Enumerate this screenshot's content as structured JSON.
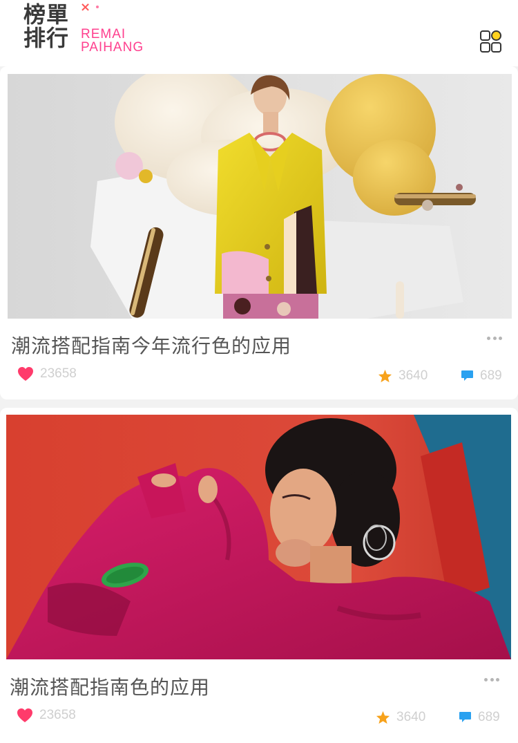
{
  "header": {
    "logo_zh_line1": "榜單",
    "logo_zh_line2": "排行",
    "logo_x": "×",
    "logo_en_line1": "REMAI",
    "logo_en_line2": "PAIHANG",
    "menu_icon": "grid-menu-icon"
  },
  "colors": {
    "accent_pink": "#ff3f8e",
    "logo_teal": "#28d7d2",
    "like_red": "#ff3b6b",
    "star_orange": "#f7a21b",
    "comment_blue": "#2aa1f0",
    "stat_text": "#cfcfcf"
  },
  "articles": [
    {
      "image": "woman-yellow-coat-photo",
      "title": "潮流搭配指南今年流行色的应用",
      "likes": "23658",
      "stars": "3640",
      "comments": "689"
    },
    {
      "image": "woman-magenta-outfit-photo",
      "title": "潮流搭配指南色的应用",
      "likes": "23658",
      "stars": "3640",
      "comments": "689"
    }
  ]
}
